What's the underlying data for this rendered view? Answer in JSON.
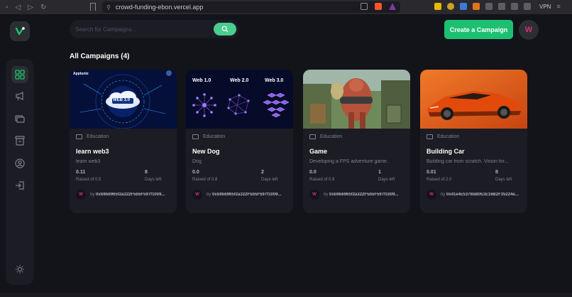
{
  "browser": {
    "url": "crowd-funding-ebon.vercel.app",
    "vpn_label": "VPN"
  },
  "search": {
    "placeholder": "Search for Campaigns..."
  },
  "header": {
    "create_label": "Create a Campaign",
    "avatar_letter": "W"
  },
  "page_title": "All Campaigns (4)",
  "sidebar": {
    "items": [
      {
        "icon": "dashboard-icon",
        "active": true
      },
      {
        "icon": "megaphone-icon",
        "active": false
      },
      {
        "icon": "payment-icon",
        "active": false
      },
      {
        "icon": "withdraw-icon",
        "active": false
      },
      {
        "icon": "profile-icon",
        "active": false
      },
      {
        "icon": "logout-icon",
        "active": false
      }
    ],
    "theme_icon": "sun-icon"
  },
  "campaigns": [
    {
      "category": "Education",
      "title": "learn web3",
      "description": "learn web3",
      "raised": "0.11",
      "raised_label": "Raised of 0.5",
      "days": "8",
      "days_label": "Days left",
      "owner_prefix": "by",
      "owner": "0xb9b6965f2a322F5b5F597f1009...",
      "image_text": "WEB 3.0",
      "image_logo": "Apptunix"
    },
    {
      "category": "Education",
      "title": "New Dog",
      "description": "Dog",
      "raised": "0.0",
      "raised_label": "Raised of 0.8",
      "days": "2",
      "days_label": "Days left",
      "owner_prefix": "by",
      "owner": "0xb9b6965f2a322F5b5F597f1009...",
      "image_labels": [
        "Web 1.0",
        "Web 2.0",
        "Web 3.0"
      ]
    },
    {
      "category": "Education",
      "title": "Game",
      "description": "Developing a FPS adventure game.",
      "raised": "0.0",
      "raised_label": "Raised of 0.8",
      "days": "1",
      "days_label": "Days left",
      "owner_prefix": "by",
      "owner": "0xb9b6965f2a322F5b5F597f1009..."
    },
    {
      "category": "Education",
      "title": "Building Car",
      "description": "Building car from scratch. Vision for...",
      "raised": "0.01",
      "raised_label": "Raised of 2.0",
      "days": "8",
      "days_label": "Days left",
      "owner_prefix": "by",
      "owner": "0x41e4c5376bB051E16B2F35224e..."
    }
  ],
  "colors": {
    "accent": "#1dc071",
    "background": "#13131a",
    "card": "#1c1c24"
  }
}
